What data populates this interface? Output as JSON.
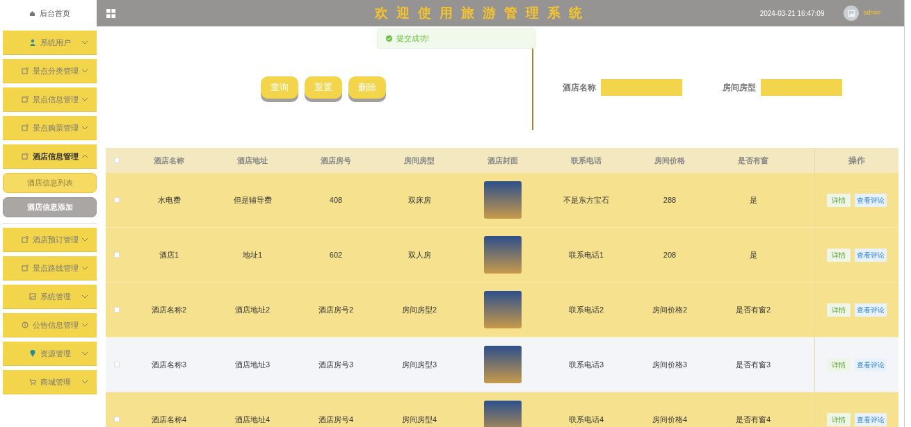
{
  "sidebar": {
    "home": "后台首页",
    "items": [
      {
        "label": "系统用户",
        "kind": "person",
        "expanded": false
      },
      {
        "label": "景点分类管理",
        "kind": "note",
        "expanded": false
      },
      {
        "label": "景点信息管理",
        "kind": "note",
        "expanded": false
      },
      {
        "label": "景点购票管理",
        "kind": "note",
        "expanded": false
      },
      {
        "label": "酒店信息管理",
        "kind": "note",
        "expanded": true,
        "children": [
          {
            "label": "酒店信息列表",
            "selected": false
          },
          {
            "label": "酒店信息添加",
            "selected": true
          }
        ]
      },
      {
        "label": "酒店预订管理",
        "kind": "note",
        "expanded": false
      },
      {
        "label": "景点路线管理",
        "kind": "note",
        "expanded": false
      },
      {
        "label": "系统管理",
        "kind": "image",
        "expanded": false
      },
      {
        "label": "公告信息管理",
        "kind": "info",
        "expanded": false
      },
      {
        "label": "资源管理",
        "kind": "pin",
        "expanded": false
      },
      {
        "label": "商城管理",
        "kind": "cart",
        "expanded": false
      }
    ]
  },
  "header": {
    "title": "欢迎使用旅游管理系统",
    "datetime": "2024-03-21 16:47:09",
    "user": "admin"
  },
  "toast": {
    "message": "提交成功!"
  },
  "actions": [
    "查询",
    "重置",
    "删除"
  ],
  "search_fields": [
    {
      "label": "酒店名称"
    },
    {
      "label": "房间房型"
    }
  ],
  "table": {
    "select_all_checked": false,
    "columns": [
      "酒店名称",
      "酒店地址",
      "酒店房号",
      "房间房型",
      "酒店封面",
      "联系电话",
      "房间价格",
      "是否有窗",
      "操作"
    ],
    "rows": [
      {
        "shaded": true,
        "checked": false,
        "cells": [
          "水电费",
          "但是辅导费",
          "408",
          "双床房",
          "",
          "不是东方宝石",
          "288",
          "是"
        ],
        "buttons": [
          "详情",
          "查看评论"
        ]
      },
      {
        "shaded": true,
        "checked": false,
        "cells": [
          "酒店1",
          "地址1",
          "602",
          "双人房",
          "",
          "联系电话1",
          "208",
          "是"
        ],
        "buttons": [
          "详情",
          "查看评论"
        ]
      },
      {
        "shaded": true,
        "checked": false,
        "cells": [
          "酒店名称2",
          "酒店地址2",
          "酒店房号2",
          "房间房型2",
          "",
          "联系电话2",
          "房间价格2",
          "是否有窗2"
        ],
        "buttons": [
          "详情",
          "查看评论"
        ]
      },
      {
        "shaded": false,
        "checked": false,
        "cells": [
          "酒店名称3",
          "酒店地址3",
          "酒店房号3",
          "房间房型3",
          "",
          "联系电话3",
          "房间价格3",
          "是否有窗3"
        ],
        "buttons": [
          "详情",
          "查看评论"
        ]
      },
      {
        "shaded": true,
        "checked": false,
        "cells": [
          "酒店名称4",
          "酒店地址4",
          "酒店房号4",
          "房间房型4",
          "",
          "联系电话4",
          "房间价格4",
          "是否有窗4"
        ],
        "buttons": [
          "详情",
          "查看评论"
        ]
      }
    ]
  }
}
